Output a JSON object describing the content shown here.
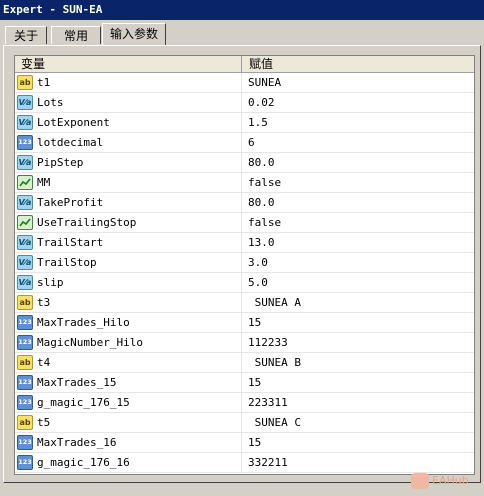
{
  "window": {
    "title": "Expert - SUN-EA"
  },
  "tabs": [
    {
      "label": "关于"
    },
    {
      "label": "常用"
    },
    {
      "label": "输入参数"
    }
  ],
  "grid": {
    "headers": {
      "name": "变量",
      "value": "赋值"
    },
    "rows": [
      {
        "icon": "string-icon",
        "badge": "ab",
        "name": "t1",
        "value": "SUNEA"
      },
      {
        "icon": "double-icon",
        "badge": "V⁄a",
        "name": "Lots",
        "value": "0.02"
      },
      {
        "icon": "double-icon",
        "badge": "V⁄a",
        "name": "LotExponent",
        "value": "1.5"
      },
      {
        "icon": "integer-icon",
        "badge": "123",
        "name": "lotdecimal",
        "value": "6"
      },
      {
        "icon": "double-icon",
        "badge": "V⁄a",
        "name": "PipStep",
        "value": "80.0"
      },
      {
        "icon": "boolean-icon",
        "badge": "",
        "name": "MM",
        "value": "false"
      },
      {
        "icon": "double-icon",
        "badge": "V⁄a",
        "name": "TakeProfit",
        "value": "80.0"
      },
      {
        "icon": "boolean-icon",
        "badge": "",
        "name": "UseTrailingStop",
        "value": "false"
      },
      {
        "icon": "double-icon",
        "badge": "V⁄a",
        "name": "TrailStart",
        "value": "13.0"
      },
      {
        "icon": "double-icon",
        "badge": "V⁄a",
        "name": "TrailStop",
        "value": "3.0"
      },
      {
        "icon": "double-icon",
        "badge": "V⁄a",
        "name": "slip",
        "value": "5.0"
      },
      {
        "icon": "string-icon",
        "badge": "ab",
        "name": "t3",
        "value": " SUNEA A"
      },
      {
        "icon": "integer-icon",
        "badge": "123",
        "name": "MaxTrades_Hilo",
        "value": "15"
      },
      {
        "icon": "integer-icon",
        "badge": "123",
        "name": "MagicNumber_Hilo",
        "value": "112233"
      },
      {
        "icon": "string-icon",
        "badge": "ab",
        "name": "t4",
        "value": " SUNEA B"
      },
      {
        "icon": "integer-icon",
        "badge": "123",
        "name": "MaxTrades_15",
        "value": "15"
      },
      {
        "icon": "integer-icon",
        "badge": "123",
        "name": "g_magic_176_15",
        "value": "223311"
      },
      {
        "icon": "string-icon",
        "badge": "ab",
        "name": "t5",
        "value": " SUNEA C"
      },
      {
        "icon": "integer-icon",
        "badge": "123",
        "name": "MaxTrades_16",
        "value": "15"
      },
      {
        "icon": "integer-icon",
        "badge": "123",
        "name": "g_magic_176_16",
        "value": "332211"
      }
    ]
  },
  "watermark": {
    "text": "EAHub"
  },
  "colors": {
    "titlebar": "#0a246a",
    "dialog": "#d4d0c8",
    "grid_bg": "#ffffff"
  }
}
